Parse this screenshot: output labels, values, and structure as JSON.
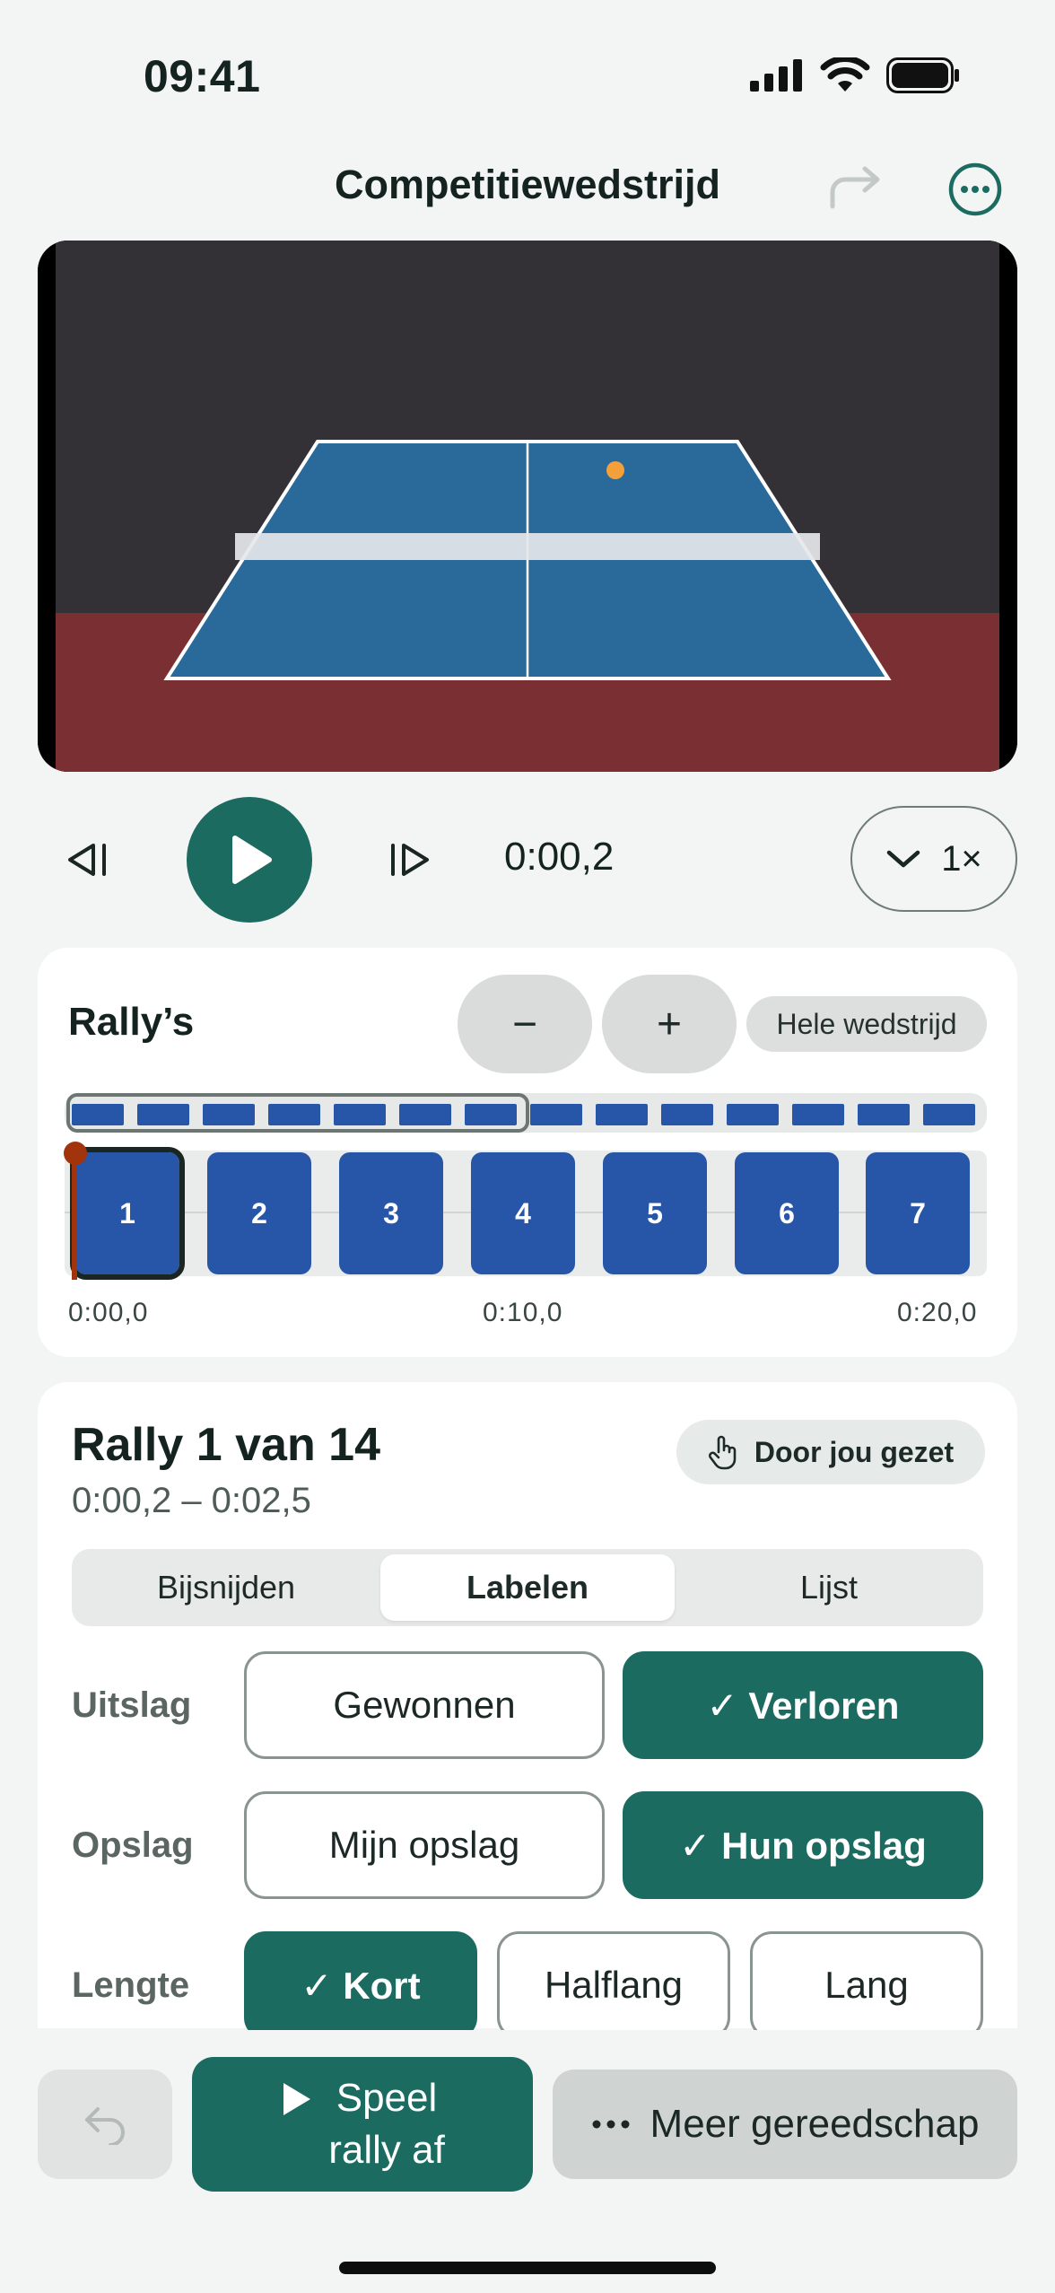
{
  "status": {
    "time": "09:41"
  },
  "nav": {
    "title": "Competitiewedstrijd"
  },
  "playback": {
    "time": "0:00,2",
    "speed": "1×"
  },
  "rallies": {
    "title": "Rally’s",
    "zoom_out": "−",
    "zoom_in": "+",
    "whole_match": "Hele wedstrijd",
    "overview_count": 14,
    "blocks": [
      "1",
      "2",
      "3",
      "4",
      "5",
      "6",
      "7"
    ],
    "ticks": [
      "0:00,0",
      "0:10,0",
      "0:20,0"
    ]
  },
  "detail": {
    "title": "Rally 1 van 14",
    "range": "0:00,2 – 0:02,5",
    "badge": "Door jou gezet",
    "tabs": [
      "Bijsnijden",
      "Labelen",
      "Lijst"
    ],
    "active_tab": "Labelen",
    "rows": {
      "uitslag": {
        "label": "Uitslag",
        "options": [
          "Gewonnen",
          "✓ Verloren"
        ],
        "selected": "✓ Verloren"
      },
      "opslag": {
        "label": "Opslag",
        "options": [
          "Mijn opslag",
          "✓ Hun opslag"
        ],
        "selected": "✓ Hun opslag"
      },
      "lengte": {
        "label": "Lengte",
        "options": [
          "✓ Kort",
          "Halflang",
          "Lang"
        ],
        "selected": "✓ Kort"
      }
    }
  },
  "bottom": {
    "play_line1": "Speel",
    "play_line2": "rally af",
    "more": "Meer gereedschap"
  },
  "colors": {
    "accent": "#1b6b61",
    "rally_blue": "#2755a8",
    "playhead": "#a1340d"
  }
}
